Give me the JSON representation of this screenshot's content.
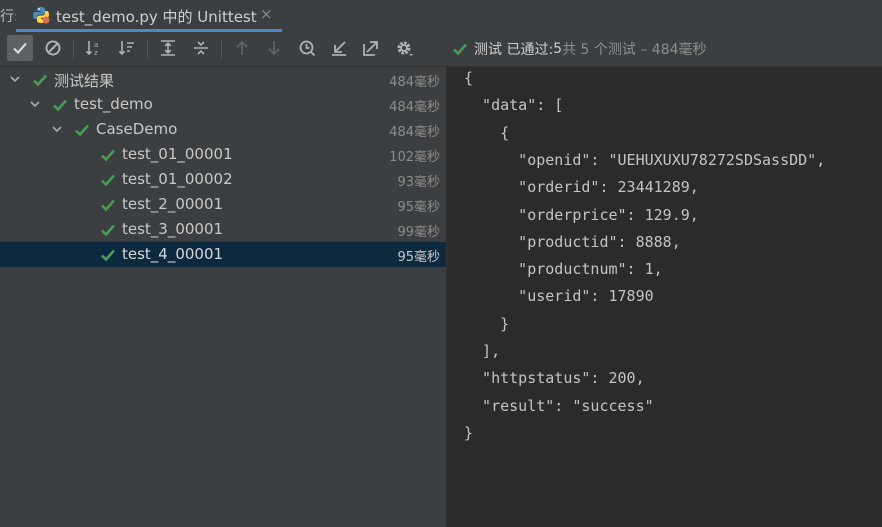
{
  "tab": {
    "prefix": "行:",
    "title": "test_demo.py 中的 Unittest",
    "close": "×"
  },
  "toolbar": {
    "buttons": [
      {
        "name": "show-passed-icon",
        "active": true
      },
      {
        "name": "show-ignored-icon",
        "active": false
      },
      {
        "name": "sort-alphabetically-icon",
        "active": false
      },
      {
        "name": "sort-by-duration-icon",
        "active": false
      },
      {
        "name": "expand-all-icon",
        "active": false
      },
      {
        "name": "collapse-all-icon",
        "active": false
      },
      {
        "name": "previous-failed-icon",
        "active": false
      },
      {
        "name": "next-failed-icon",
        "active": false
      },
      {
        "name": "test-history-icon",
        "active": false
      },
      {
        "name": "import-tests-icon",
        "active": false
      },
      {
        "name": "export-results-icon",
        "active": false
      },
      {
        "name": "settings-gear-icon",
        "active": false
      }
    ],
    "status": {
      "label": "测试 已通过: ",
      "count": "5",
      "total": "共 5 个测试 – 484毫秒"
    }
  },
  "tree": [
    {
      "name": "测试结果",
      "time": "484毫秒",
      "level": 0,
      "expandable": true,
      "selected": false
    },
    {
      "name": "test_demo",
      "time": "484毫秒",
      "level": 1,
      "expandable": true,
      "selected": false
    },
    {
      "name": "CaseDemo",
      "time": "484毫秒",
      "level": 2,
      "expandable": true,
      "selected": false
    },
    {
      "name": "test_01_00001",
      "time": "102毫秒",
      "level": 3,
      "expandable": false,
      "selected": false
    },
    {
      "name": "test_01_00002",
      "time": "93毫秒",
      "level": 3,
      "expandable": false,
      "selected": false
    },
    {
      "name": "test_2_00001",
      "time": "95毫秒",
      "level": 3,
      "expandable": false,
      "selected": false
    },
    {
      "name": "test_3_00001",
      "time": "99毫秒",
      "level": 3,
      "expandable": false,
      "selected": false
    },
    {
      "name": "test_4_00001",
      "time": "95毫秒",
      "level": 3,
      "expandable": false,
      "selected": true
    }
  ],
  "console": {
    "lines": [
      "{",
      "  \"data\": [",
      "    {",
      "      \"openid\": \"UEHUXUXU78272SDSassDD\",",
      "      \"orderid\": 23441289,",
      "      \"orderprice\": 129.9,",
      "      \"productid\": 8888,",
      "      \"productnum\": 1,",
      "      \"userid\": 17890",
      "    }",
      "  ],",
      "  \"httpstatus\": 200,",
      "  \"result\": \"success\"",
      "}"
    ]
  },
  "colors": {
    "pass_green": "#499c54",
    "selection": "#0d293e",
    "tab_underline": "#4a88c7"
  }
}
